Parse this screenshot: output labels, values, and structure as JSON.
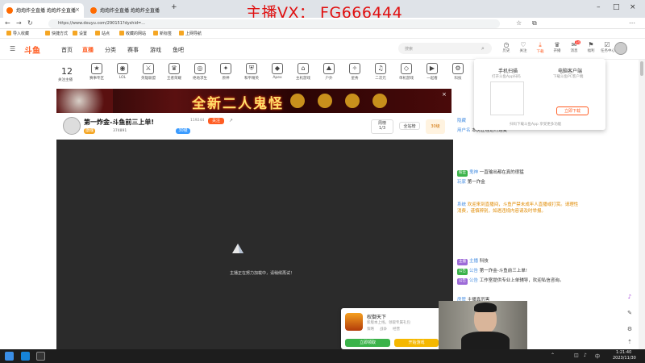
{
  "browser": {
    "tabs": [
      {
        "label": "炮炮炸全直播 炮炮炸全直播"
      },
      {
        "label": "炮炮炸全直播 炮炮炸全直播"
      }
    ],
    "watermark": "主播VX： FG666444",
    "url": "https://www.douyu.com/290151?dyshid=...",
    "bookmarks": [
      "导入收藏",
      "快捷方式",
      "设置",
      "站点",
      "收藏的网站",
      "新标签",
      "上网导航"
    ]
  },
  "header": {
    "logo": "斗鱼",
    "nav": [
      "首页",
      "直播",
      "分类",
      "赛事",
      "游戏",
      "鱼吧"
    ],
    "active_nav": 1,
    "search_placeholder": "搜索",
    "icons": [
      {
        "icon": "history-icon",
        "label": "历史"
      },
      {
        "icon": "heart-icon",
        "label": "关注"
      },
      {
        "icon": "download-icon",
        "label": "下载"
      },
      {
        "icon": "crown-icon",
        "label": "开播"
      },
      {
        "icon": "mail-icon",
        "label": "消息"
      },
      {
        "icon": "gift-icon",
        "label": "福利"
      },
      {
        "icon": "task-icon",
        "label": "任务中心"
      },
      {
        "icon": "user-icon",
        "label": "我的"
      }
    ],
    "badge_count": "34"
  },
  "categories": {
    "follow_count": "12",
    "follow_label": "关注主播",
    "items": [
      "赛事专区",
      "LOL",
      "英雄联盟",
      "王者荣耀",
      "绝地求生",
      "原神",
      "和平精英",
      "Apex",
      "主机游戏",
      "户外",
      "星秀",
      "二次元",
      "单机游戏",
      "一起看",
      "科技"
    ]
  },
  "banner": {
    "text": "全新二人鬼怪"
  },
  "room": {
    "title": "第一炸金-斗鱼前三上单!",
    "follow_label": "关注",
    "follow_count": "119244",
    "host_label": "旗魂",
    "viewers": "374891",
    "rank_label": "周榜",
    "rank_value": "1/3",
    "ranking_label": "全站榜",
    "level_label": "30级"
  },
  "player": {
    "loading_text": "主播正在努力加载中，请稍候再试！"
  },
  "dropdown": {
    "left_title": "手机扫描",
    "left_sub": "打开斗鱼App扫码",
    "right_title": "电脑客户端",
    "right_sub": "下载斗鱼PC客户端",
    "download_button": "立即下载",
    "footer": "扫码下载斗鱼App 享受更多功能"
  },
  "chat": {
    "lines": [
      {
        "user": "隐藏",
        "text": "",
        "tag": "",
        "color": "normal"
      },
      {
        "user": "用户名",
        "text": "本房正在进行连麦",
        "tag": "",
        "color": "normal"
      },
      {
        "user": "鬼神",
        "text": "一直输出都在真的很猛",
        "tag": "粉丝",
        "color": "normal"
      },
      {
        "user": "玩家",
        "text": "第一炸金",
        "tag": "",
        "color": "normal"
      },
      {
        "user": "系统",
        "text": "欢迎来到直播间，斗鱼严禁未成年人直播或打赏。请理性消费，谨慎辨别，如遇违规内容请及时举报。",
        "tag": "",
        "color": "orange"
      },
      {
        "user": "主播",
        "text": "科技",
        "tag": "主播",
        "color": "normal"
      },
      {
        "user": "公告",
        "text": "第一炸金-斗鱼前三上单!",
        "tag": "公告",
        "color": "normal"
      },
      {
        "user": "公告",
        "text": "工作室提供专业上单辅导，欢迎私信咨询。",
        "tag": "公告",
        "color": "normal"
      },
      {
        "user": "房管",
        "text": "主播真厉害",
        "tag": "",
        "color": "normal"
      }
    ]
  },
  "game_popup": {
    "title": "权御天下",
    "subtitle": "新版本上线，领取专属礼包",
    "tags": [
      "策略",
      "战争",
      "经营"
    ],
    "btn_left": "立即领取",
    "btn_right": "开始游戏"
  },
  "taskbar": {
    "time": "1:21:40",
    "date": "2023/11/30",
    "lang": "中"
  },
  "colors": {
    "accent": "#ff5d23",
    "watermark": "#e01010",
    "player_bg": "#2b2b2b"
  }
}
